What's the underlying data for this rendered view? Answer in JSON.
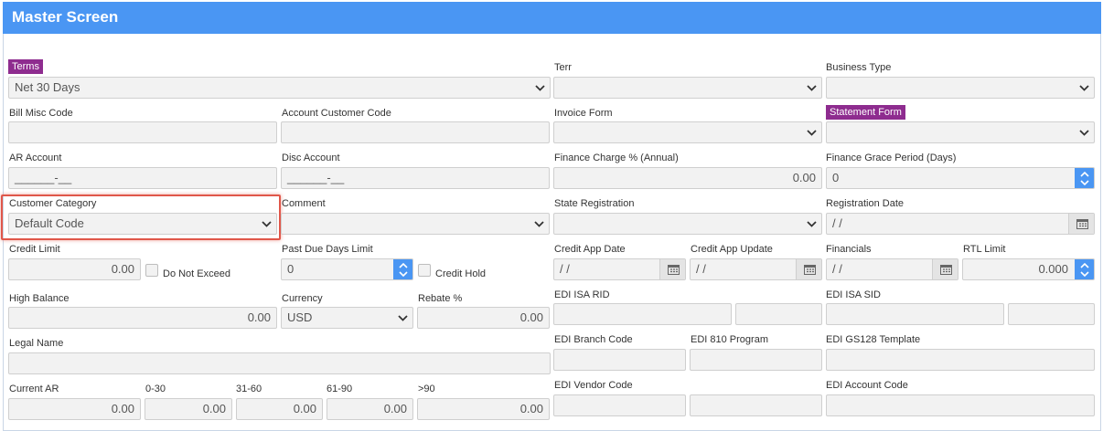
{
  "header": {
    "title": "Master Screen"
  },
  "terms": {
    "label": "Terms",
    "value": "Net 30 Days"
  },
  "terr": {
    "label": "Terr",
    "value": ""
  },
  "business_type": {
    "label": "Business Type",
    "value": ""
  },
  "bill_misc_code": {
    "label": "Bill Misc Code",
    "value": ""
  },
  "account_customer_code": {
    "label": "Account Customer Code",
    "value": ""
  },
  "invoice_form": {
    "label": "Invoice Form",
    "value": ""
  },
  "statement_form": {
    "label": "Statement Form",
    "value": ""
  },
  "ar_account": {
    "label": "AR Account",
    "value": "______-__"
  },
  "disc_account": {
    "label": "Disc Account",
    "value": "______-__"
  },
  "finance_charge": {
    "label": "Finance Charge % (Annual)",
    "value": "0.00"
  },
  "finance_grace": {
    "label": "Finance Grace Period (Days)",
    "value": "0"
  },
  "customer_category": {
    "label": "Customer Category",
    "value": "Default Code"
  },
  "comment": {
    "label": "Comment",
    "value": ""
  },
  "state_registration": {
    "label": "State Registration",
    "value": ""
  },
  "registration_date": {
    "label": "Registration Date",
    "value": " /  /"
  },
  "credit_limit": {
    "label": "Credit Limit",
    "value": "0.00"
  },
  "do_not_exceed": {
    "label": "Do Not Exceed",
    "checked": false
  },
  "past_due_days_limit": {
    "label": "Past Due Days Limit",
    "value": "0"
  },
  "credit_hold": {
    "label": "Credit Hold",
    "checked": false
  },
  "credit_app_date": {
    "label": "Credit App Date",
    "value": " /  /"
  },
  "credit_app_update": {
    "label": "Credit App Update",
    "value": " /  /"
  },
  "financials": {
    "label": "Financials",
    "value": " /  /"
  },
  "rtl_limit": {
    "label": "RTL Limit",
    "value": "0.000"
  },
  "high_balance": {
    "label": "High Balance",
    "value": "0.00"
  },
  "currency": {
    "label": "Currency",
    "value": "USD"
  },
  "rebate": {
    "label": "Rebate %",
    "value": "0.00"
  },
  "edi_isa_rid": {
    "label": "EDI ISA RID",
    "value": "",
    "value2": ""
  },
  "edi_isa_sid": {
    "label": "EDI ISA SID",
    "value": "",
    "value2": ""
  },
  "legal_name": {
    "label": "Legal Name",
    "value": ""
  },
  "edi_branch_code": {
    "label": "EDI Branch Code",
    "value": ""
  },
  "edi_810_program": {
    "label": "EDI 810 Program",
    "value": ""
  },
  "edi_gs128_template": {
    "label": "EDI GS128 Template",
    "value": ""
  },
  "current_ar": {
    "label": "Current AR",
    "value": "0.00"
  },
  "aging_0_30": {
    "label": "0-30",
    "value": "0.00"
  },
  "aging_31_60": {
    "label": "31-60",
    "value": "0.00"
  },
  "aging_61_90": {
    "label": "61-90",
    "value": "0.00"
  },
  "aging_over_90": {
    "label": ">90",
    "value": "0.00"
  },
  "edi_vendor_code": {
    "label": "EDI Vendor Code",
    "value": "",
    "value2": ""
  },
  "edi_account_code": {
    "label": "EDI Account Code",
    "value": ""
  },
  "colors": {
    "header": "#4a96f3",
    "badge": "#8e2c8f",
    "highlight": "#e0574a"
  },
  "icons": [
    "chevron-down-icon",
    "spinner-up-icon",
    "spinner-down-icon",
    "calendar-icon"
  ]
}
